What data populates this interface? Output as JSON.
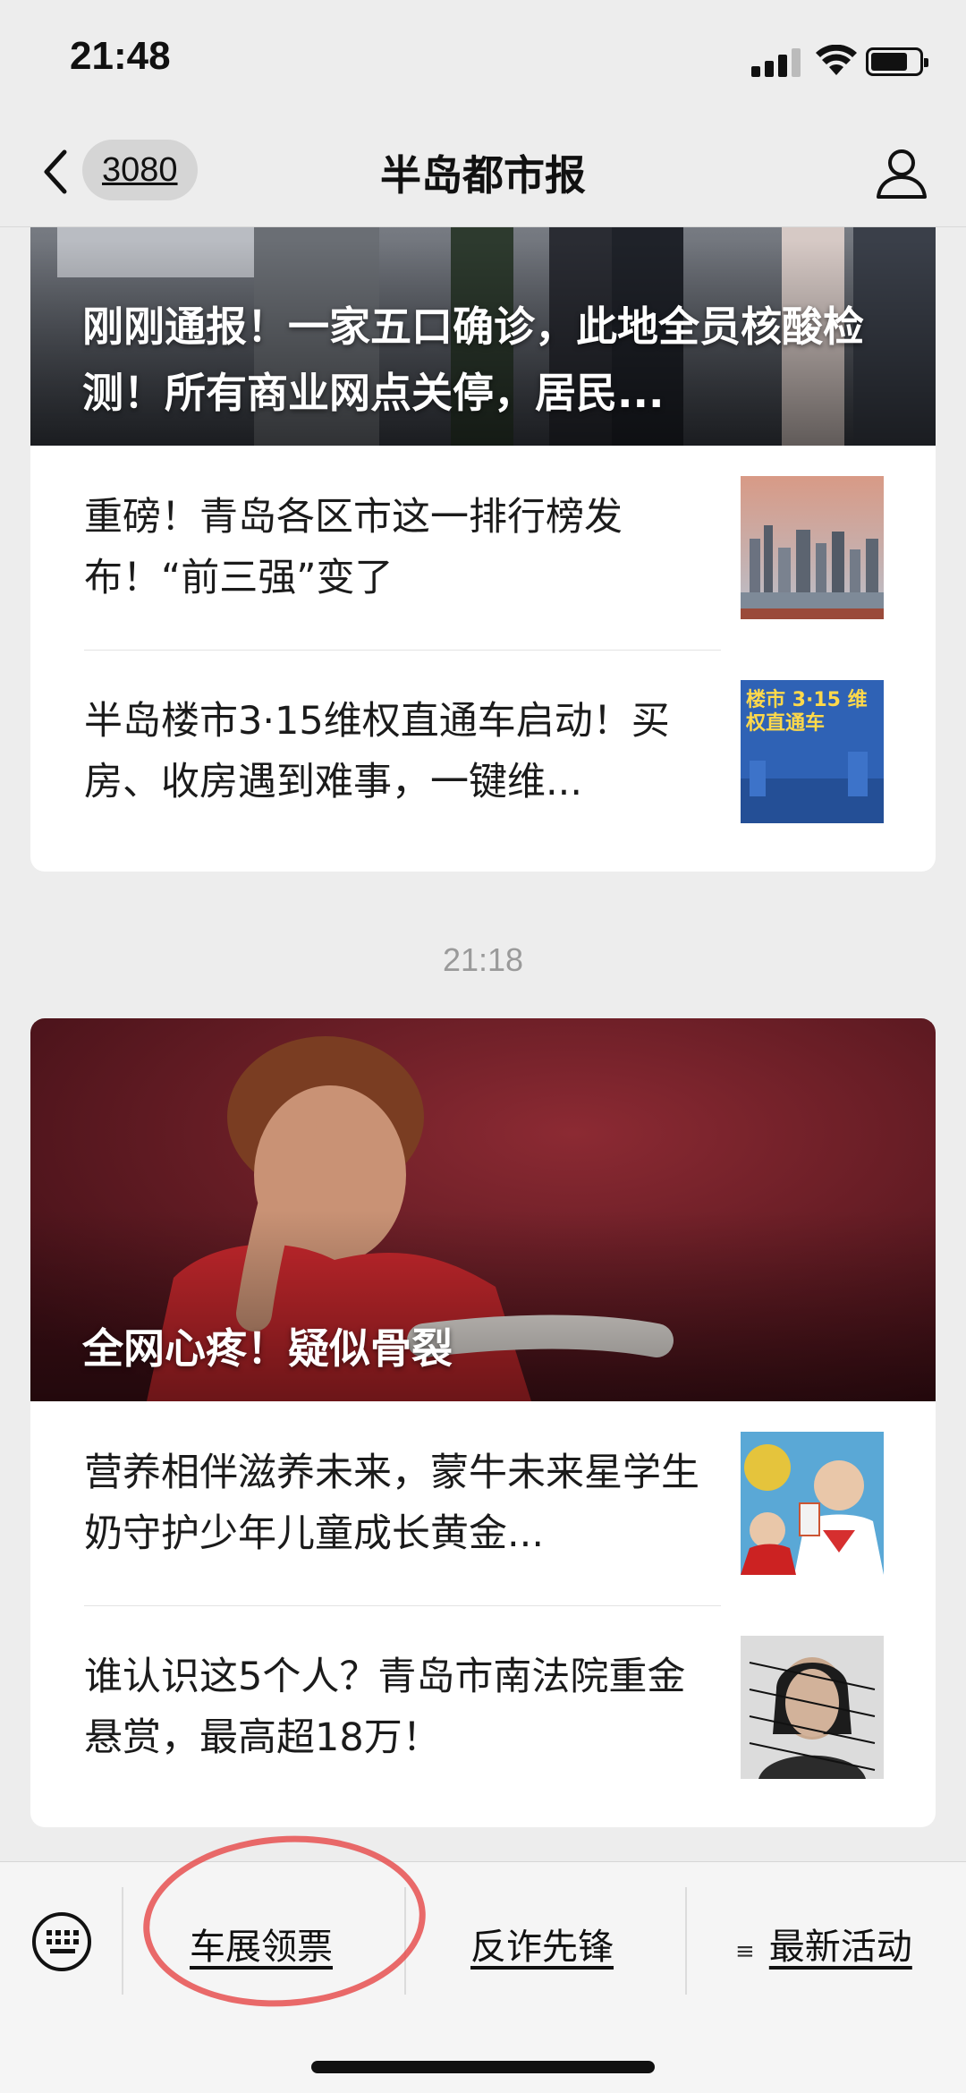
{
  "status_bar": {
    "time": "21:48"
  },
  "nav": {
    "unread_count": "3080",
    "title": "半岛都市报"
  },
  "feed": {
    "group1": {
      "hero_title": "刚刚通报！一家五口确诊，此地全员核酸检测！所有商业网点关停，居民...",
      "items": [
        {
          "title": "重磅！青岛各区市这一排行榜发布！“前三强”变了"
        },
        {
          "title": "半岛楼市3·15维权直通车启动！买房、收房遇到难事，一键维..."
        }
      ],
      "thumb_315_text": "楼市 3·15 维权直通车"
    },
    "timestamp": "21:18",
    "group2": {
      "hero_title": "全网心疼！疑似骨裂",
      "items": [
        {
          "title": "营养相伴滋养未来，蒙牛未来星学生奶守护少年儿童成长黄金..."
        },
        {
          "title": "谁认识这5个人？青岛市南法院重金悬赏，最高超18万！"
        }
      ]
    }
  },
  "bottom_menu": {
    "items": [
      {
        "label": "车展领票"
      },
      {
        "label": "反诈先锋"
      },
      {
        "label": "最新活动"
      }
    ]
  },
  "colors": {
    "background": "#ededed",
    "annotation": "#e64646"
  }
}
